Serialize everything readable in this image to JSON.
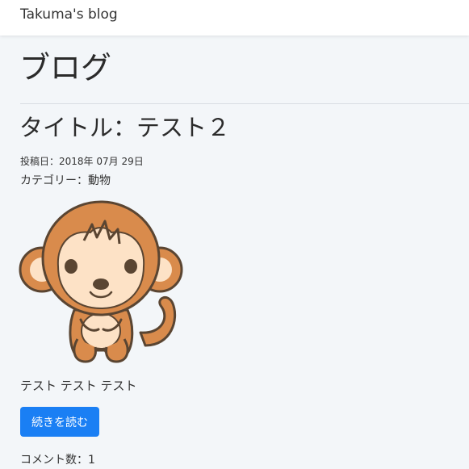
{
  "navbar": {
    "brand": "Takuma's blog"
  },
  "page": {
    "heading": "ブログ"
  },
  "post": {
    "title": "タイトル：テスト２",
    "date_line": "投稿日：2018年 07月 29日",
    "category_line": "カテゴリー：動物",
    "image_icon": "monkey-illustration",
    "excerpt": "テスト テスト テスト",
    "read_more_label": "続きを読む",
    "comment_count_line": "コメント数：1"
  },
  "colors": {
    "background": "#f3f6f9",
    "navbar": "#ffffff",
    "primary_button": "#1a7ff4",
    "monkey_fur": "#d98b4c",
    "monkey_face": "#fde2c6",
    "outline": "#5a4532"
  }
}
